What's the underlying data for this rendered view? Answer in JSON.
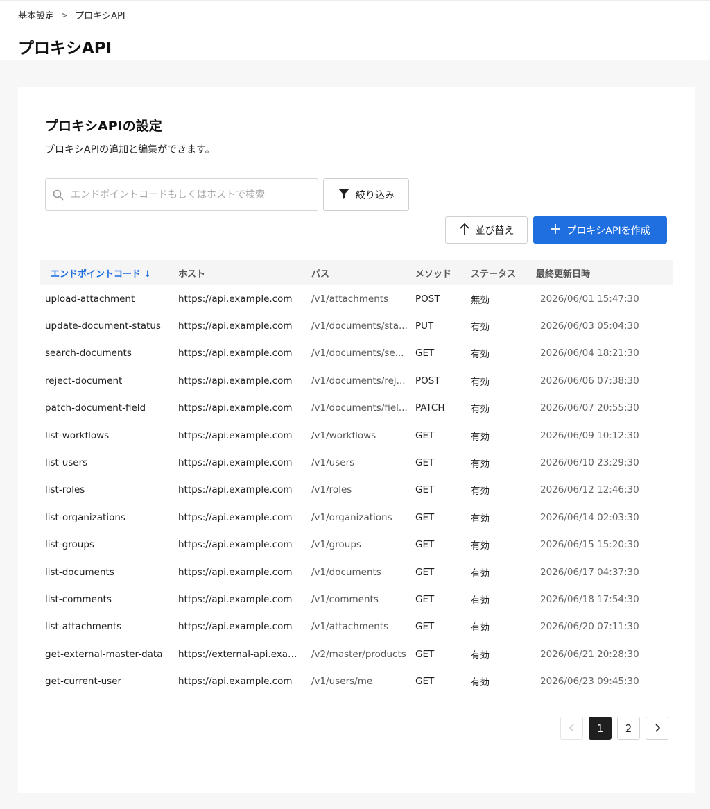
{
  "breadcrumb": {
    "parent": "基本設定",
    "separator": ">",
    "current": "プロキシAPI"
  },
  "page": {
    "title": "プロキシAPI"
  },
  "section": {
    "title": "プロキシAPIの設定",
    "description": "プロキシAPIの追加と編集ができます。"
  },
  "search": {
    "placeholder": "エンドポイントコードもしくはホストで検索",
    "value": ""
  },
  "toolbar": {
    "filter_label": "絞り込み",
    "sort_label": "並び替え",
    "create_label": "プロキシAPIを作成"
  },
  "table": {
    "columns": {
      "endpoint": "エンドポイントコード",
      "sort_indicator": "↓",
      "host": "ホスト",
      "path": "パス",
      "method": "メソッド",
      "status": "ステータス",
      "updated": "最終更新日時"
    },
    "rows": [
      {
        "endpoint": "upload-attachment",
        "host": "https://api.example.com",
        "path": "/v1/attachments",
        "method": "POST",
        "status": "無効",
        "updated": "2026/06/01 15:47:30"
      },
      {
        "endpoint": "update-document-status",
        "host": "https://api.example.com",
        "path": "/v1/documents/sta...",
        "method": "PUT",
        "status": "有効",
        "updated": "2026/06/03 05:04:30"
      },
      {
        "endpoint": "search-documents",
        "host": "https://api.example.com",
        "path": "/v1/documents/se...",
        "method": "GET",
        "status": "有効",
        "updated": "2026/06/04 18:21:30"
      },
      {
        "endpoint": "reject-document",
        "host": "https://api.example.com",
        "path": "/v1/documents/rej...",
        "method": "POST",
        "status": "有効",
        "updated": "2026/06/06 07:38:30"
      },
      {
        "endpoint": "patch-document-field",
        "host": "https://api.example.com",
        "path": "/v1/documents/fiel...",
        "method": "PATCH",
        "status": "有効",
        "updated": "2026/06/07 20:55:30"
      },
      {
        "endpoint": "list-workflows",
        "host": "https://api.example.com",
        "path": "/v1/workflows",
        "method": "GET",
        "status": "有効",
        "updated": "2026/06/09 10:12:30"
      },
      {
        "endpoint": "list-users",
        "host": "https://api.example.com",
        "path": "/v1/users",
        "method": "GET",
        "status": "有効",
        "updated": "2026/06/10 23:29:30"
      },
      {
        "endpoint": "list-roles",
        "host": "https://api.example.com",
        "path": "/v1/roles",
        "method": "GET",
        "status": "有効",
        "updated": "2026/06/12 12:46:30"
      },
      {
        "endpoint": "list-organizations",
        "host": "https://api.example.com",
        "path": "/v1/organizations",
        "method": "GET",
        "status": "有効",
        "updated": "2026/06/14 02:03:30"
      },
      {
        "endpoint": "list-groups",
        "host": "https://api.example.com",
        "path": "/v1/groups",
        "method": "GET",
        "status": "有効",
        "updated": "2026/06/15 15:20:30"
      },
      {
        "endpoint": "list-documents",
        "host": "https://api.example.com",
        "path": "/v1/documents",
        "method": "GET",
        "status": "有効",
        "updated": "2026/06/17 04:37:30"
      },
      {
        "endpoint": "list-comments",
        "host": "https://api.example.com",
        "path": "/v1/comments",
        "method": "GET",
        "status": "有効",
        "updated": "2026/06/18 17:54:30"
      },
      {
        "endpoint": "list-attachments",
        "host": "https://api.example.com",
        "path": "/v1/attachments",
        "method": "GET",
        "status": "有効",
        "updated": "2026/06/20 07:11:30"
      },
      {
        "endpoint": "get-external-master-data",
        "host": "https://external-api.exam...",
        "path": "/v2/master/products",
        "method": "GET",
        "status": "有効",
        "updated": "2026/06/21 20:28:30"
      },
      {
        "endpoint": "get-current-user",
        "host": "https://api.example.com",
        "path": "/v1/users/me",
        "method": "GET",
        "status": "有効",
        "updated": "2026/06/23 09:45:30"
      }
    ]
  },
  "pagination": {
    "prev_icon": "chevron-left-icon",
    "next_icon": "chevron-right-icon",
    "pages": [
      "1",
      "2"
    ],
    "current": "1"
  },
  "colors": {
    "accent": "#1f6fe0",
    "active_page": "#1f1f1f"
  }
}
